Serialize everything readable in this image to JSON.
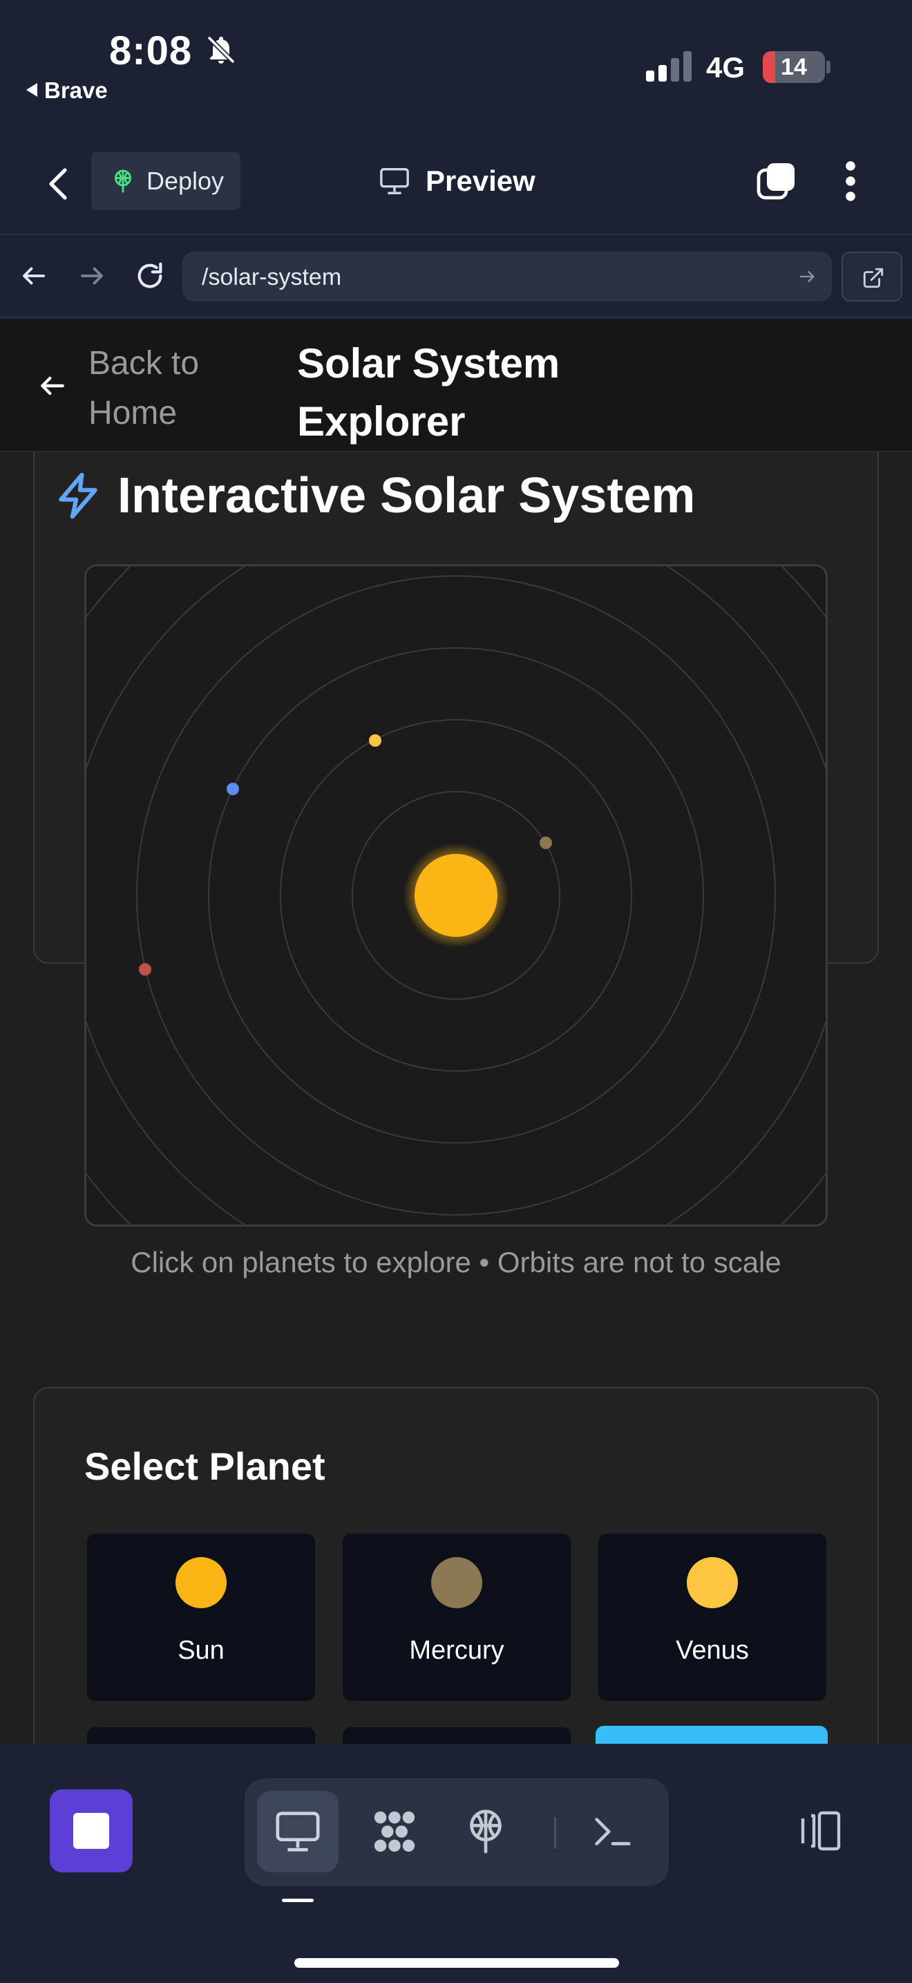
{
  "status_bar": {
    "time": "8:08",
    "back_app": "Brave",
    "network": "4G",
    "battery": "14"
  },
  "header": {
    "deploy_label": "Deploy",
    "preview_label": "Preview"
  },
  "url_bar": {
    "url": "/solar-system"
  },
  "page_header": {
    "back_label": "Back to Home",
    "title": "Solar System Explorer"
  },
  "solar_card": {
    "title": "Interactive Solar System",
    "note": "Click on planets to explore • Orbits are not to scale",
    "sun_color": "#fbb515"
  },
  "planet_select": {
    "title": "Select Planet",
    "planets": [
      {
        "name": "Sun",
        "color": "#fbb515"
      },
      {
        "name": "Mercury",
        "color": "#8c7853"
      },
      {
        "name": "Venus",
        "color": "#fdc542"
      }
    ],
    "active_color": "#38bdf8"
  },
  "colors": {
    "accent": "#5b3fd6",
    "bolt": "#60a5fa",
    "earth_dot": "#5b8def",
    "mars_dot": "#c0504d"
  }
}
